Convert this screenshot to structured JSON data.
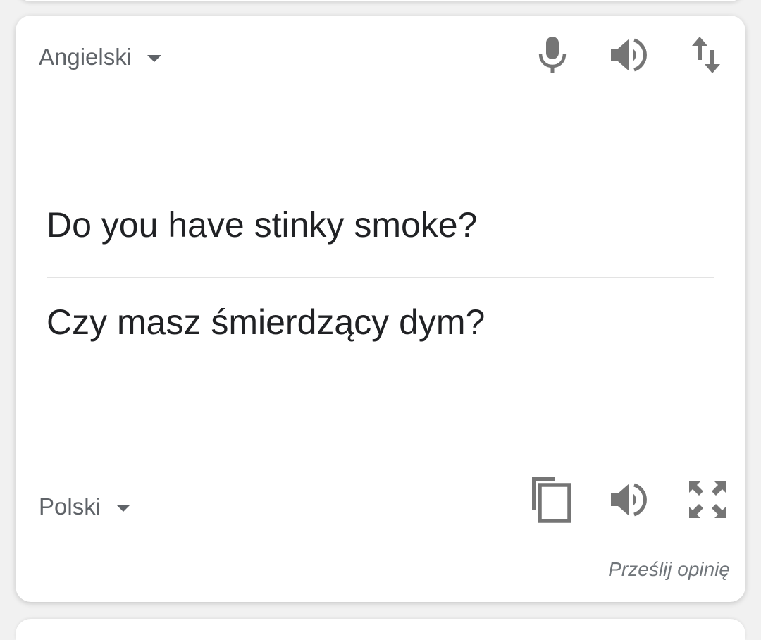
{
  "source": {
    "language": "Angielski",
    "text": "Do you have stinky smoke?"
  },
  "target": {
    "language": "Polski",
    "text": "Czy masz śmierdzący dym?"
  },
  "icons": {
    "source": [
      "microphone-icon",
      "speaker-icon",
      "swap-languages-icon"
    ],
    "target": [
      "copy-icon",
      "speaker-icon",
      "fullscreen-icon"
    ]
  },
  "feedback": {
    "label": "Prześlij opinię"
  },
  "colors": {
    "text": "#202124",
    "secondary": "#5f6368",
    "icon": "#757575",
    "divider": "#e3e3e3"
  }
}
